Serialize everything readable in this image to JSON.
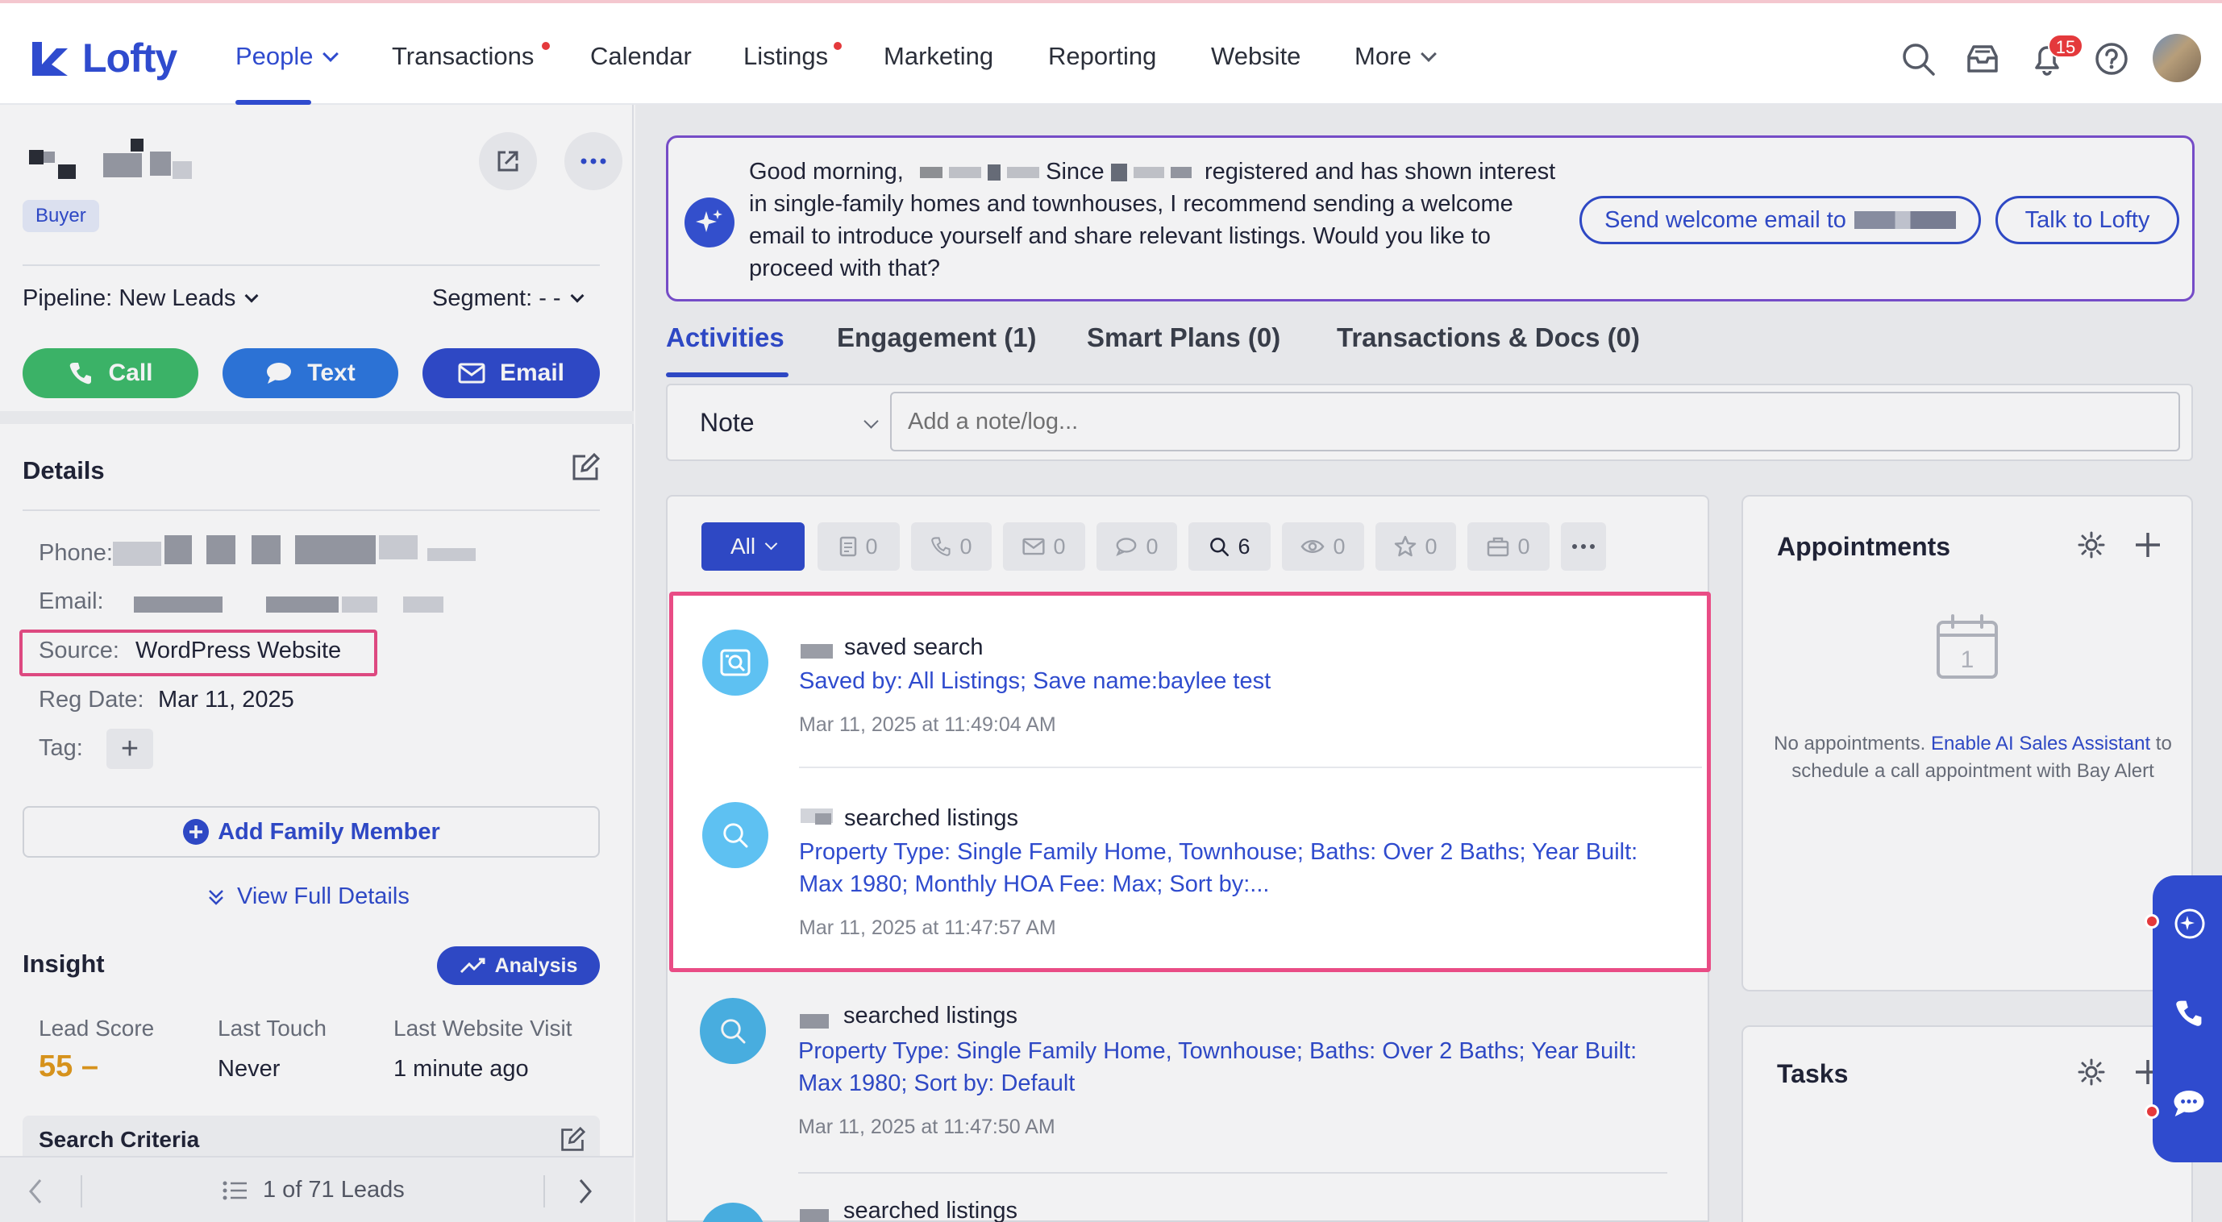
{
  "app": {
    "name": "Lofty"
  },
  "nav": {
    "items": [
      {
        "label": "People"
      },
      {
        "label": "Transactions"
      },
      {
        "label": "Calendar"
      },
      {
        "label": "Listings"
      },
      {
        "label": "Marketing"
      },
      {
        "label": "Reporting"
      },
      {
        "label": "Website"
      },
      {
        "label": "More"
      }
    ],
    "notification_count": "15"
  },
  "lead": {
    "tag": "Buyer",
    "pipeline_label": "Pipeline:",
    "pipeline_value": "New Leads",
    "segment_label": "Segment:",
    "segment_value": "- -",
    "call_label": "Call",
    "text_label": "Text",
    "email_label": "Email"
  },
  "details": {
    "title": "Details",
    "phone_label": "Phone:",
    "email_label": "Email:",
    "source_label": "Source:",
    "source_value": "WordPress Website",
    "reg_date_label": "Reg Date:",
    "reg_date_value": "Mar 11, 2025",
    "tag_label": "Tag:",
    "add_family": "Add Family Member",
    "view_full": "View Full Details"
  },
  "insight": {
    "title": "Insight",
    "analysis_label": "Analysis",
    "lead_score_label": "Lead Score",
    "lead_score_value": "55 –",
    "last_touch_label": "Last Touch",
    "last_touch_value": "Never",
    "last_visit_label": "Last Website Visit",
    "last_visit_value": "1 minute ago",
    "search_criteria": "Search Criteria"
  },
  "pager": {
    "text": "1 of 71 Leads"
  },
  "ai_banner": {
    "text_1": "Good morning,",
    "text_2": "Since",
    "text_3": "registered and has shown interest in single-family homes and townhouses, I recommend sending a welcome email to introduce yourself and share relevant listings. Would you like to proceed with that?",
    "send_email_label": "Send welcome email to",
    "talk_label": "Talk to Lofty"
  },
  "tabs": [
    {
      "label": "Activities"
    },
    {
      "label": "Engagement (1)"
    },
    {
      "label": "Smart Plans (0)"
    },
    {
      "label": "Transactions & Docs (0)"
    }
  ],
  "note": {
    "type": "Note",
    "placeholder": "Add a note/log..."
  },
  "filters": {
    "all_label": "All",
    "counts": [
      "0",
      "0",
      "0",
      "0",
      "6",
      "0",
      "0",
      "0"
    ]
  },
  "activities": [
    {
      "title": "saved search",
      "detail": "Saved by: All Listings; Save name:baylee test",
      "time": "Mar 11, 2025 at 11:49:04 AM"
    },
    {
      "title": "searched listings",
      "detail": "Property Type: Single Family Home, Townhouse; Baths: Over 2 Baths; Year Built: Max 1980; Monthly HOA Fee: Max; Sort by:...",
      "time": "Mar 11, 2025 at 11:47:57 AM"
    },
    {
      "title": "searched listings",
      "detail": "Property Type: Single Family Home, Townhouse; Baths: Over 2 Baths; Year Built: Max 1980; Sort by: Default",
      "time": "Mar 11, 2025 at 11:47:50 AM"
    },
    {
      "title": "searched listings"
    }
  ],
  "appointments": {
    "title": "Appointments",
    "empty_1": "No appointments.",
    "empty_link": "Enable AI Sales Assistant",
    "empty_2": "to schedule a call appointment with Bay Alert",
    "calendar_day": "1"
  },
  "tasks": {
    "title": "Tasks"
  },
  "colors": {
    "brand": "#2f4bce",
    "highlight": "#e94c85",
    "ai_border": "#7b4fd1",
    "call": "#3dbb6b",
    "score": "#e29a1b"
  }
}
